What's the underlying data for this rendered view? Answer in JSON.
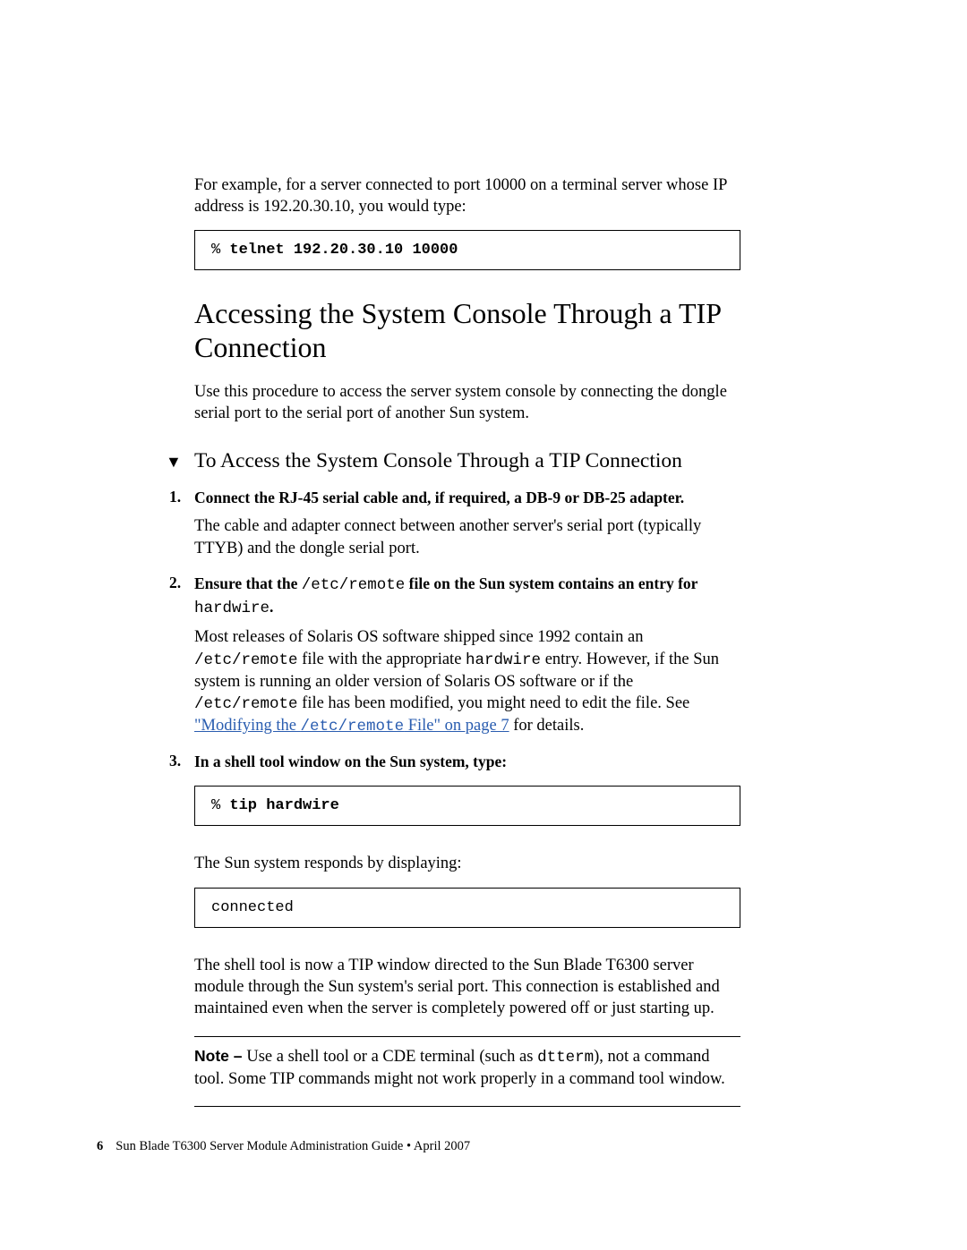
{
  "intro": {
    "example_text": "For example, for a server connected to port 10000 on a terminal server whose IP address is 192.20.30.10, you would type:",
    "code_prompt": "% ",
    "code_cmd": "telnet 192.20.30.10 10000"
  },
  "section": {
    "title": "Accessing the System Console Through a TIP Connection",
    "lead": "Use this procedure to access the server system console by connecting the dongle serial port to the serial port of another Sun system."
  },
  "procedure": {
    "marker": "▼",
    "title": "To Access the System Console Through a TIP Connection",
    "steps": [
      {
        "head": "Connect the RJ-45 serial cable and, if required, a DB-9 or DB-25 adapter.",
        "body_plain": "The cable and adapter connect between another server's serial port (typically TTYB) and the dongle serial port."
      },
      {
        "head_pre": "Ensure that the ",
        "head_code": "/etc/remote",
        "head_mid": " file on the Sun system contains an entry for ",
        "head_code2": "hardwire",
        "head_post": ".",
        "body_pre": "Most releases of Solaris OS software shipped since 1992 contain an ",
        "body_code1": "/etc/remote",
        "body_mid1": " file with the appropriate ",
        "body_code2": "hardwire",
        "body_mid2": " entry. However, if the Sun system is running an older version of Solaris OS software or if the ",
        "body_code3": "/etc/remote",
        "body_mid3": " file has been modified, you might need to edit the file. See ",
        "link_pre": "\"Modifying the ",
        "link_code": "/etc/remote",
        "link_post": " File\" on page 7",
        "body_tail": " for details."
      },
      {
        "head": "In a shell tool window on the Sun system, type:",
        "code_prompt": "% ",
        "code_cmd": "tip hardwire",
        "after1": "The Sun system responds by displaying:",
        "code2": "connected",
        "after2": "The shell tool is now a TIP window directed to the Sun Blade T6300 server module through the Sun system's serial port. This connection is established and maintained even when the server is completely powered off or just starting up."
      }
    ]
  },
  "note": {
    "label": "Note – ",
    "text_pre": "Use a shell tool or a CDE terminal (such as ",
    "code": "dtterm",
    "text_post": "), not a command tool. Some TIP commands might not work properly in a command tool window."
  },
  "footer": {
    "page_num": "6",
    "text": "Sun Blade T6300 Server Module Administration Guide • April 2007"
  }
}
